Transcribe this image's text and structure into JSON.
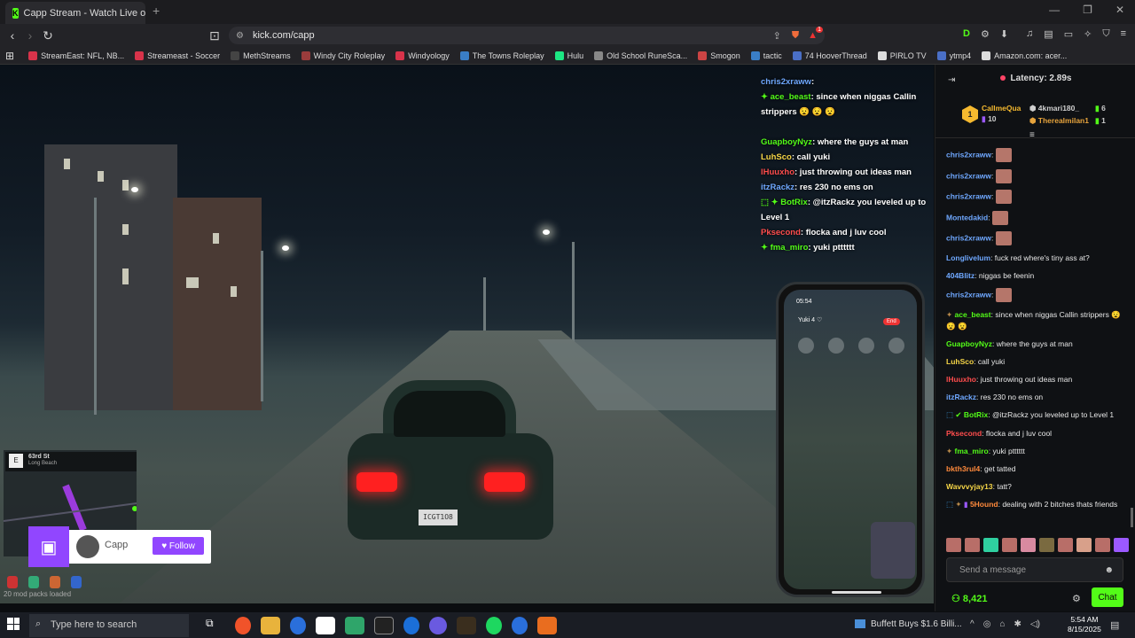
{
  "browser": {
    "tab_title": "Capp Stream - Watch Live on",
    "url": "kick.com/capp",
    "bookmarks": [
      {
        "label": "StreamEast: NFL, NB...",
        "color": "#d8334a"
      },
      {
        "label": "Streameast - Soccer",
        "color": "#d8334a"
      },
      {
        "label": "MethStreams",
        "color": "#444444"
      },
      {
        "label": "Windy City Roleplay",
        "color": "#9a3c3c"
      },
      {
        "label": "Windyology",
        "color": "#d8334a"
      },
      {
        "label": "The Towns Roleplay",
        "color": "#3a7ec6"
      },
      {
        "label": "Hulu",
        "color": "#1ce783"
      },
      {
        "label": "Old School RuneSca...",
        "color": "#888888"
      },
      {
        "label": "Smogon",
        "color": "#c44"
      },
      {
        "label": "tactic",
        "color": "#3a7ec6"
      },
      {
        "label": "74 HooverThread",
        "color": "#4a6fc6"
      },
      {
        "label": "PIRLO TV",
        "color": "#ddd"
      },
      {
        "label": "ytmp4",
        "color": "#4a6fc6"
      },
      {
        "label": "Amazon.com: acer...",
        "color": "#ddd"
      }
    ],
    "notification_count": "1"
  },
  "overlay_chat": [
    {
      "user": "chris2xraww",
      "text": ": ",
      "color": "#6fa8ff",
      "icon": ""
    },
    {
      "user": "ace_beast",
      "text": ": since when niggas Callin strippers 😧 😧 😧",
      "color": "#53fc18",
      "icon": "✦ "
    },
    {
      "user": "GuapboyNyz",
      "text": ": where the guys at man",
      "color": "#53fc18",
      "icon": ""
    },
    {
      "user": "LuhSco",
      "text": ": call yuki",
      "color": "#f5d547",
      "icon": ""
    },
    {
      "user": "lHuuxho",
      "text": ": just throwing out ideas man",
      "color": "#ff4d4d",
      "icon": ""
    },
    {
      "user": "itzRackz",
      "text": ": res 230 no ems on",
      "color": "#6fa8ff",
      "icon": ""
    },
    {
      "user": "BotRix",
      "text": ": @itzRackz you leveled up to Level 1",
      "color": "#53fc18",
      "icon": "⬚ ✦ "
    },
    {
      "user": "Pksecond",
      "text": ": flocka and j luv cool",
      "color": "#ff4d4d",
      "icon": ""
    },
    {
      "user": "fma_miro",
      "text": ": yuki ptttttt",
      "color": "#53fc18",
      "icon": "✦ "
    }
  ],
  "phone": {
    "time": "05:54",
    "caller": "Yuki 4 ♡",
    "end_label": "End"
  },
  "minimap": {
    "street": "63rd St",
    "district": "Long Beach",
    "compass": "E"
  },
  "follow_widget": {
    "streamer": "Capp",
    "button": "Follow"
  },
  "mod_packs": "20 mod packs loaded",
  "chat_panel": {
    "latency": "Latency: 2.89s",
    "leaderboard": [
      {
        "rank": "1",
        "name": "CallmeQua",
        "count": "10",
        "color": "#f5b92f"
      },
      {
        "name": "4kmari180_",
        "count": "6",
        "color": "#cfcfcf"
      },
      {
        "name": "Therealmilan1",
        "count": "1",
        "color": "#e6a33c"
      }
    ],
    "messages": [
      {
        "user": "chris2xraww",
        "text": "",
        "color": "#6fa8ff",
        "emote": true
      },
      {
        "user": "chris2xraww",
        "text": "",
        "color": "#6fa8ff",
        "emote": true
      },
      {
        "user": "chris2xraww",
        "text": "",
        "color": "#6fa8ff",
        "emote": true
      },
      {
        "user": "Montedakid",
        "text": "",
        "color": "#6fa8ff",
        "emote": true
      },
      {
        "user": "chris2xraww",
        "text": "",
        "color": "#6fa8ff",
        "emote": true
      },
      {
        "user": "Longlivelum",
        "text": "fuck red where's tiny ass at?",
        "color": "#6fa8ff",
        "emote": false
      },
      {
        "user": "404Blitz",
        "text": "niggas be feenin",
        "color": "#6fa8ff",
        "emote": false
      },
      {
        "user": "chris2xraww",
        "text": "",
        "color": "#6fa8ff",
        "emote": true
      },
      {
        "user": "ace_beast",
        "text": "since when niggas Callin strippers 😧 😧 😧",
        "color": "#53fc18",
        "emote": false
      },
      {
        "user": "GuapboyNyz",
        "text": "where the guys at man",
        "color": "#53fc18",
        "emote": false
      },
      {
        "user": "LuhSco",
        "text": "call yuki",
        "color": "#f5d547",
        "emote": false
      },
      {
        "user": "lHuuxho",
        "text": "just throwing out ideas man",
        "color": "#ff4d4d",
        "emote": false
      },
      {
        "user": "itzRackz",
        "text": "res 230 no ems on",
        "color": "#6fa8ff",
        "emote": false
      },
      {
        "user": "BotRix",
        "text": "@itzRackz you leveled up to Level 1",
        "color": "#53fc18",
        "emote": false
      },
      {
        "user": "Pksecond",
        "text": "flocka and j luv cool",
        "color": "#ff4d4d",
        "emote": false
      },
      {
        "user": "fma_miro",
        "text": "yuki ptttttt",
        "color": "#53fc18",
        "emote": false
      },
      {
        "user": "bkth3rul4",
        "text": "get tatted",
        "color": "#ff8a3c",
        "emote": false
      },
      {
        "user": "Wavvvyjay13",
        "text": "tatt?",
        "color": "#f5d547",
        "emote": false
      },
      {
        "user": "5Hound",
        "text": "dealing with 2 bitches thats friends",
        "color": "#ff8a3c",
        "emote": false
      }
    ],
    "send_placeholder": "Send a message",
    "viewer_count": "8,421",
    "chat_button": "Chat"
  },
  "taskbar": {
    "search_placeholder": "Type here to search",
    "news": "Buffett Buys $1.6 Billi...",
    "time": "5:54 AM",
    "date": "8/15/2025"
  }
}
